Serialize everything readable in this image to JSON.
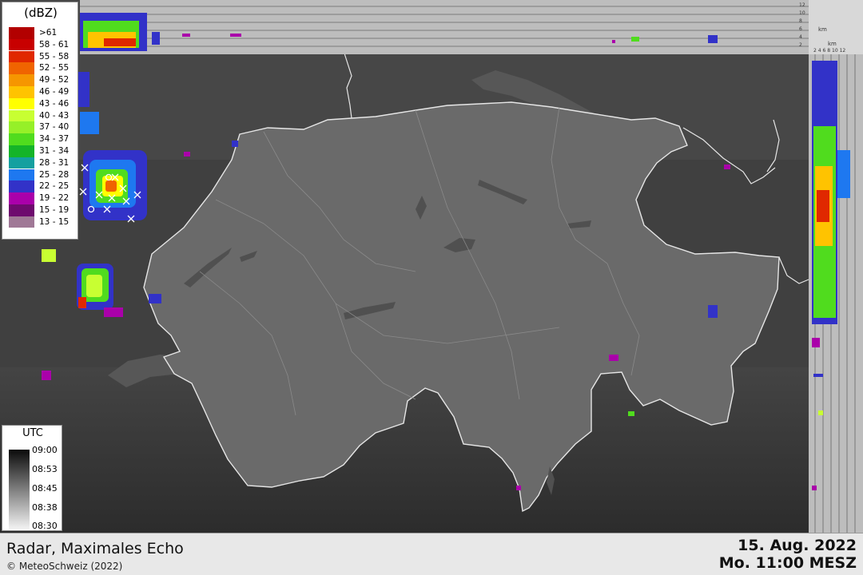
{
  "legend": {
    "title": "(dBZ)",
    "items": [
      {
        "label": ">61",
        "color": "#b20000"
      },
      {
        "label": "58 - 61",
        "color": "#c80000"
      },
      {
        "label": "55 - 58",
        "color": "#e02800"
      },
      {
        "label": "52 - 55",
        "color": "#f06400"
      },
      {
        "label": "49 - 52",
        "color": "#f69600"
      },
      {
        "label": "46 - 49",
        "color": "#ffc300"
      },
      {
        "label": "43 - 46",
        "color": "#ffff00"
      },
      {
        "label": "40 - 43",
        "color": "#c8ff32"
      },
      {
        "label": "37 - 40",
        "color": "#96f028"
      },
      {
        "label": "34 - 37",
        "color": "#50dc1e"
      },
      {
        "label": "31 - 34",
        "color": "#14b428"
      },
      {
        "label": "28 - 31",
        "color": "#14a0a0"
      },
      {
        "label": "25 - 28",
        "color": "#1e78f0"
      },
      {
        "label": "22 - 25",
        "color": "#3232c8"
      },
      {
        "label": "19 - 22",
        "color": "#aa00aa"
      },
      {
        "label": "15 - 19",
        "color": "#6e0a6e"
      },
      {
        "label": "13 - 15",
        "color": "#a07896"
      }
    ]
  },
  "utc_legend": {
    "title": "UTC",
    "ticks": [
      "09:00",
      "08:53",
      "08:45",
      "08:38",
      "08:30"
    ]
  },
  "top_profile_scale": {
    "ticks": [
      "12",
      "10",
      "8",
      "6",
      "4",
      "2"
    ],
    "unit": "km"
  },
  "side_profile_scale": {
    "ticks": [
      "2",
      "4",
      "6",
      "8",
      "10",
      "12"
    ],
    "unit": "km"
  },
  "footer": {
    "product": "Radar, Maximales Echo",
    "copyright": "© MeteoSchweiz (2022)",
    "date": "15. Aug. 2022",
    "time": "Mo. 11:00 MESZ"
  },
  "colors": {
    "map_background": "#3c3c3c",
    "switzerland": "#6a6a6a",
    "border_line": "#e6e6e6",
    "profile_background": "#bdbdbd"
  }
}
